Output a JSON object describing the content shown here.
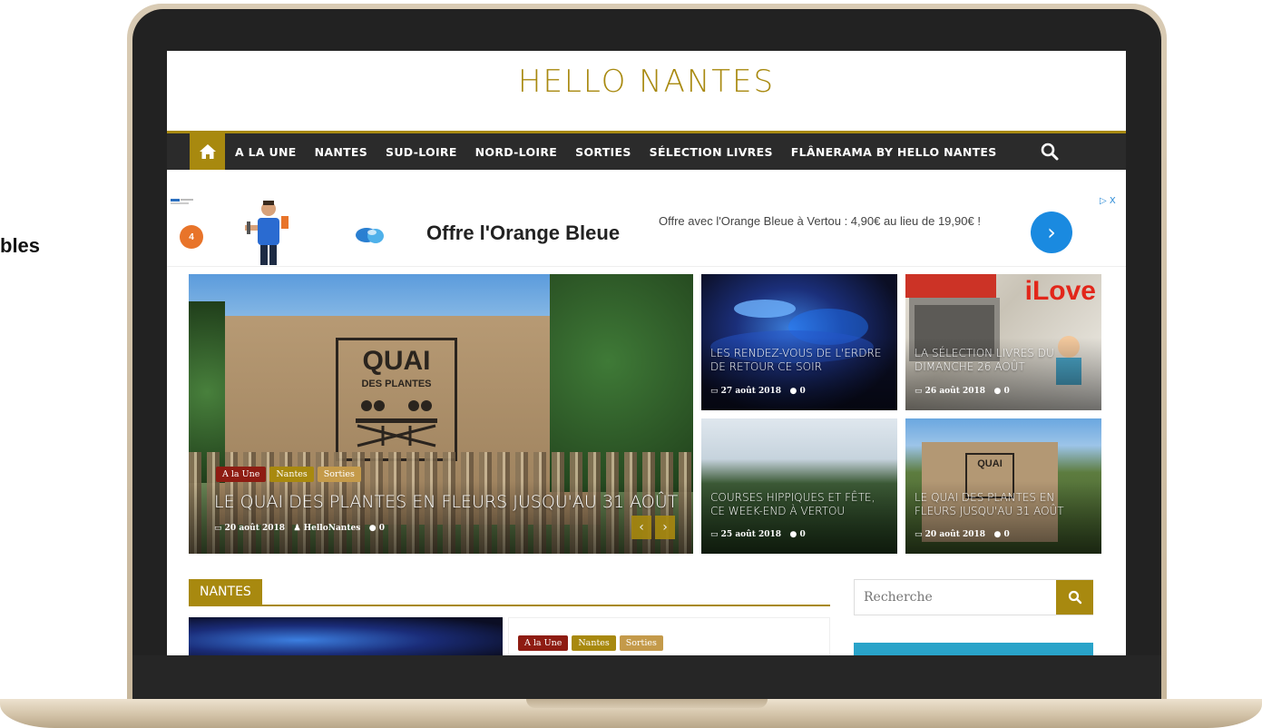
{
  "side_text": "bles",
  "site": {
    "title": "HELLO NANTES"
  },
  "nav": {
    "items": [
      "A LA UNE",
      "NANTES",
      "SUD-LOIRE",
      "NORD-LOIRE",
      "SORTIES",
      "SÉLECTION LIVRES",
      "FLÂNERAMA BY HELLO NANTES"
    ],
    "home_icon": "home-icon",
    "search_icon": "search-icon"
  },
  "ad": {
    "headline": "Offre l'Orange Bleue",
    "description": "Offre avec l'Orange Bleue à Vertou : 4,90€ au lieu de 19,90€ !",
    "badge": "4",
    "adchoices": "▷ X"
  },
  "featured": {
    "main": {
      "tags": [
        "A la Une",
        "Nantes",
        "Sorties"
      ],
      "title": "LE QUAI DES PLANTES EN FLEURS JUSQU'AU 31 AOÛT",
      "date": "20 août 2018",
      "author": "HelloNantes",
      "comments": "0",
      "sign_line1": "QUAI",
      "sign_line2": "DES PLANTES"
    },
    "tiles": [
      {
        "title": "LES RENDEZ-VOUS DE L'ERDRE DE RETOUR CE SOIR",
        "date": "27 août 2018",
        "comments": "0"
      },
      {
        "title": "LA SÉLECTION LIVRES DU DIMANCHE 26 AOÛT",
        "date": "26 août 2018",
        "comments": "0",
        "overlay_text": "iLove"
      },
      {
        "title": "COURSES HIPPIQUES ET FÊTE, CE WEEK-END À VERTOU",
        "date": "25 août 2018",
        "comments": "0"
      },
      {
        "title": "LE QUAI DES PLANTES EN FLEURS JUSQU'AU 31 AOÛT",
        "date": "20 août 2018",
        "comments": "0",
        "sign_text": "QUAI"
      }
    ]
  },
  "section": {
    "title": "NANTES",
    "tags": [
      "A la Une",
      "Nantes",
      "Sorties"
    ]
  },
  "sidebar": {
    "search_placeholder": "Recherche"
  },
  "colors": {
    "accent": "#a8890f",
    "nav_bg": "#2b2b2b",
    "tag_red": "#8e1c12",
    "tag_tan": "#c49a4a",
    "ad_button": "#1a8ae0"
  }
}
